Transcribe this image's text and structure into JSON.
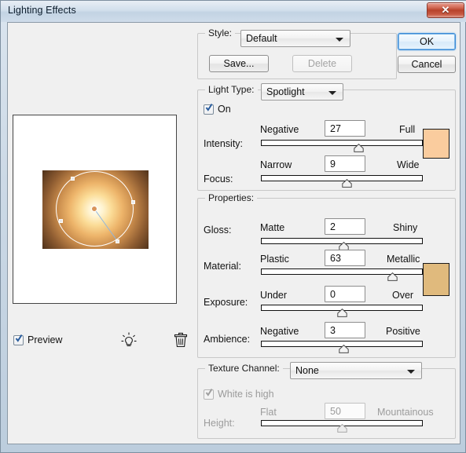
{
  "window": {
    "title": "Lighting Effects",
    "close_label": "✕"
  },
  "preview": {
    "checkbox_label": "Preview",
    "new_light_icon": "light-bulb-icon",
    "delete_light_icon": "trash-icon"
  },
  "style": {
    "group_label": "Style:",
    "selected": "Default",
    "save_label": "Save...",
    "delete_label": "Delete"
  },
  "dialog_buttons": {
    "ok_label": "OK",
    "cancel_label": "Cancel"
  },
  "light_type": {
    "group_label": "Light Type:",
    "selected": "Spotlight",
    "on_label": "On",
    "sliders": [
      {
        "name": "Intensity:",
        "min_label": "Negative",
        "max_label": "Full",
        "value": "27",
        "position_pct": 60
      },
      {
        "name": "Focus:",
        "min_label": "Narrow",
        "max_label": "Wide",
        "value": "9",
        "position_pct": 53
      }
    ],
    "color_swatch": "#facc9e"
  },
  "properties": {
    "group_label": "Properties:",
    "sliders": [
      {
        "name": "Gloss:",
        "min_label": "Matte",
        "max_label": "Shiny",
        "value": "2",
        "position_pct": 51
      },
      {
        "name": "Material:",
        "min_label": "Plastic",
        "max_label": "Metallic",
        "value": "63",
        "position_pct": 81
      },
      {
        "name": "Exposure:",
        "min_label": "Under",
        "max_label": "Over",
        "value": "0",
        "position_pct": 50
      },
      {
        "name": "Ambience:",
        "min_label": "Negative",
        "max_label": "Positive",
        "value": "3",
        "position_pct": 51
      }
    ],
    "color_swatch": "#e0ba7d"
  },
  "texture_channel": {
    "group_label": "Texture Channel:",
    "selected": "None",
    "white_is_high_label": "White is high",
    "height_slider": {
      "name": "Height:",
      "min_label": "Flat",
      "max_label": "Mountainous",
      "value": "50",
      "position_pct": 50
    }
  }
}
